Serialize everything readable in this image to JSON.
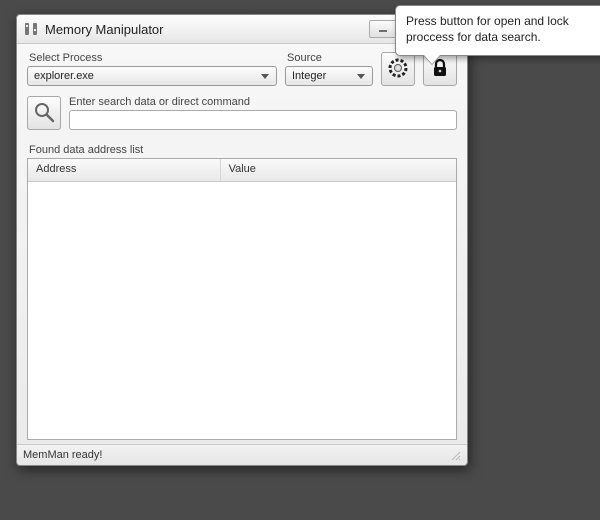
{
  "window": {
    "title": "Memory Manipulator"
  },
  "labels": {
    "select_process": "Select Process",
    "source": "Source",
    "search_prompt": "Enter search data or direct command",
    "found_list": "Found data address list"
  },
  "process_combo": {
    "value": "explorer.exe"
  },
  "source_combo": {
    "value": "Integer"
  },
  "search_input": {
    "value": ""
  },
  "columns": {
    "address": "Address",
    "value": "Value"
  },
  "status": {
    "text": "MemMan ready!"
  },
  "tooltip": {
    "text": "Press button for open and lock proccess for data search."
  }
}
